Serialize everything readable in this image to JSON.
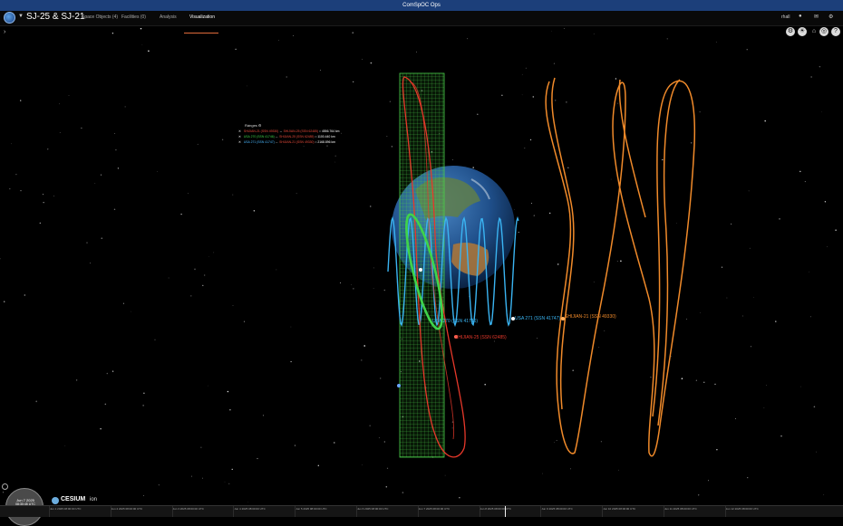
{
  "window": {
    "title": "ComSpOC Ops"
  },
  "header": {
    "title": "SJ-25 & SJ-21",
    "tabs": [
      {
        "label": "Space Objects (4)"
      },
      {
        "label": "Facilities (0)"
      },
      {
        "label": "Analysis"
      },
      {
        "label": "Visualization"
      }
    ],
    "active_tab": "Visualization",
    "user": "rhall"
  },
  "ranges": {
    "title": "Ranges",
    "rows": [
      {
        "from": "SHIJIAN-21 (SSN 49330)",
        "to": "SHIJIAN-25 (SSN 62485)",
        "value": "4556.764 km",
        "from_color": "#e84a3a",
        "to_color": "#e84a3a"
      },
      {
        "from": "USA 270 (SSN 41746)",
        "to": "SHIJIAN-25 (SSN 62485)",
        "value": "1100.440 km",
        "from_color": "#3fd44a",
        "to_color": "#e84a3a"
      },
      {
        "from": "USA 271 (SSN 41747)",
        "to": "SHIJIAN-21 (SSN 49330)",
        "value": "2168.896 km",
        "from_color": "#4ab8ff",
        "to_color": "#e84a3a"
      }
    ]
  },
  "scene_labels": {
    "usa271": "USA 271 (SSN 41747)",
    "usa270": "USA 270 (SSN 41746)",
    "shijian25": "SHIJIAN-25 (SSN 62485)",
    "shijian21": "SHIJIAN-21 (SSN 49330)"
  },
  "colors": {
    "usa271": "#3ab4f2",
    "usa270": "#3fd44a",
    "shijian25": "#e6382a",
    "shijian21": "#f08a2a",
    "accent": "#e06a3a"
  },
  "clock": {
    "date": "Jun 7 2025",
    "time": "08:30:45 UTC"
  },
  "cesium": {
    "brand": "CESIUM",
    "suffix": "ion"
  },
  "timeline": {
    "ticks": [
      "Jun 1 2025 08:00:00 UTC",
      "Jun 2 2025 08:00:00 UTC",
      "Jun 3 2025 08:00:00 UTC",
      "Jun 4 2025 08:00:00 UTC",
      "Jun 5 2025 08:00:00 UTC",
      "Jun 6 2025 08:00:00 UTC",
      "Jun 7 2025 08:00:00 UTC",
      "Jun 8 2025 08:00:00 UTC",
      "Jun 9 2025 08:00:00 UTC",
      "Jun 10 2025 08:00:00 UTC",
      "Jun 11 2025 08:00:00 UTC",
      "Jun 12 2025 08:00:00 UTC"
    ]
  },
  "icons": {
    "settings": "gear-icon",
    "sun": "sun-icon",
    "home": "home-icon",
    "globe": "globe-icon",
    "help": "help-icon",
    "user": "user-icon",
    "mail": "mail-icon",
    "menu": "settings-icon"
  }
}
